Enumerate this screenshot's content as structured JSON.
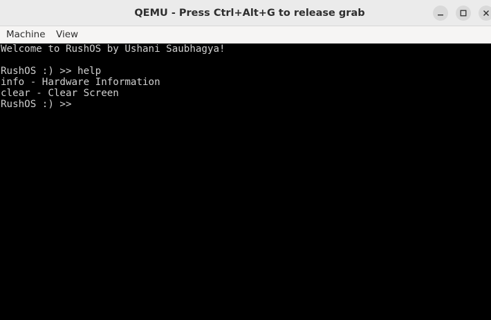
{
  "window": {
    "title": "QEMU - Press Ctrl+Alt+G to release grab"
  },
  "menubar": {
    "items": [
      {
        "label": "Machine"
      },
      {
        "label": "View"
      }
    ]
  },
  "terminal": {
    "lines": [
      "Welcome to RushOS by Ushani Saubhagya!",
      "",
      "RushOS :) >> help",
      "info - Hardware Information",
      "clear - Clear Screen",
      "RushOS :) >>"
    ],
    "background_color": "#000000",
    "text_color": "#d0d0d0"
  },
  "icons": {
    "minimize": "minimize-icon",
    "maximize": "maximize-icon",
    "close": "close-icon"
  }
}
